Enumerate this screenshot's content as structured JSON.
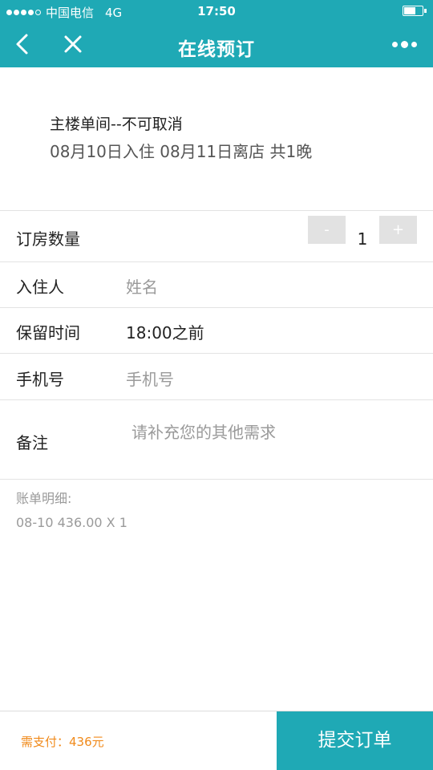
{
  "status_bar": {
    "carrier": "中国电信",
    "network": "4G",
    "time": "17:50"
  },
  "nav": {
    "title": "在线预订",
    "back_icon": "chevron-left-icon",
    "close_icon": "close-icon",
    "more_icon": "more-dots-icon"
  },
  "room": {
    "name": "主楼单间--不可取消",
    "dates": "08月10日入住 08月11日离店 共1晚"
  },
  "form": {
    "quantity": {
      "label": "订房数量",
      "minus": "-",
      "value": "1",
      "plus": "+"
    },
    "guest": {
      "label": "入住人",
      "placeholder": "姓名"
    },
    "hold_time": {
      "label": "保留时间",
      "value": "18:00之前"
    },
    "phone": {
      "label": "手机号",
      "placeholder": "手机号"
    },
    "remark": {
      "label": "备注",
      "placeholder": "请补充您的其他需求"
    }
  },
  "bill": {
    "title": "账单明细:",
    "lines": [
      "08-10 436.00 X 1"
    ]
  },
  "footer": {
    "pay_amount": "需支付：436元",
    "submit_label": "提交订单"
  },
  "colors": {
    "brand": "#1fa9b5",
    "pay_accent": "#f08a1b"
  }
}
